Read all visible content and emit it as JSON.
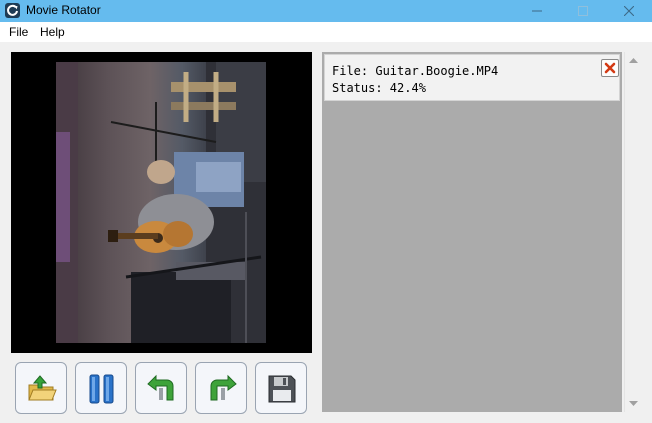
{
  "window": {
    "title": "Movie Rotator",
    "icon": "movie-rotator-app-icon",
    "controls": [
      "minimize-icon",
      "maximize-icon",
      "close-icon"
    ]
  },
  "menu": {
    "file_label": "File",
    "help_label": "Help"
  },
  "preview": {
    "content": "rotated video frame"
  },
  "toolbar": {
    "buttons": [
      {
        "name": "open",
        "icon": "folder-open-icon"
      },
      {
        "name": "pause",
        "icon": "pause-icon"
      },
      {
        "name": "rotate-left",
        "icon": "rotate-left-icon"
      },
      {
        "name": "rotate-right",
        "icon": "rotate-right-icon"
      },
      {
        "name": "save",
        "icon": "floppy-disk-icon"
      }
    ]
  },
  "job": {
    "file_text": "File: Guitar.Boogie.MP4",
    "status_text": "Status: 42.4%",
    "progress_percent": 42.4,
    "remove_icon": "remove-x-icon"
  },
  "colors": {
    "titlebar": "#65bbee",
    "status_area": "#ababab",
    "remove_icon": "#d33a14",
    "rotate_arrow": "#3ea33a",
    "pause_blue": "#2a72c8"
  }
}
